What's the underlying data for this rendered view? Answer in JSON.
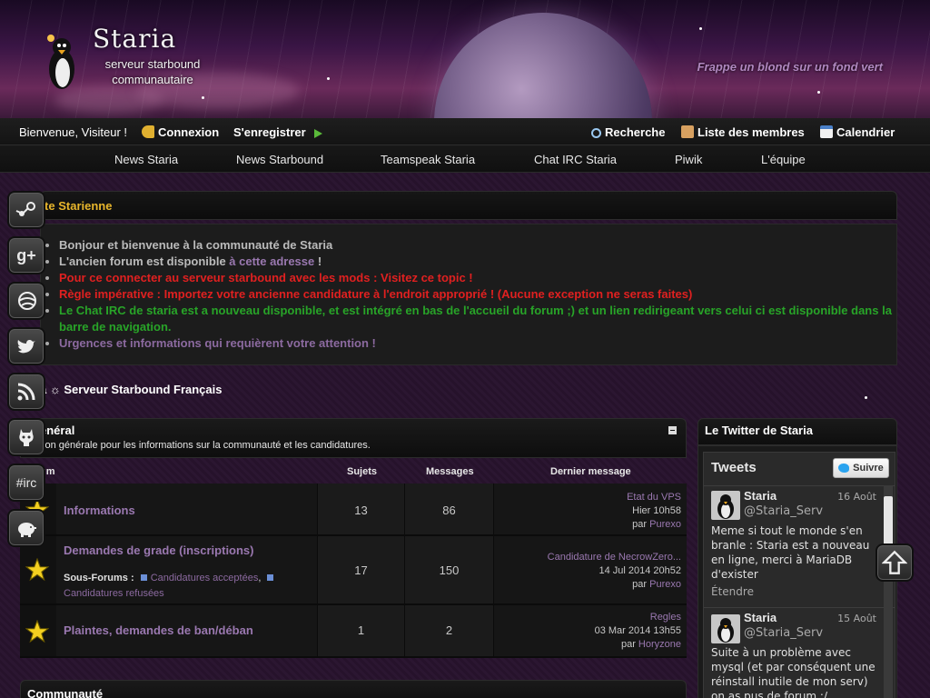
{
  "banner": {
    "logo_title": "Staria",
    "logo_sub_1": "serveur starbound",
    "logo_sub_2": "communautaire",
    "tagline": "Frappe un blond sur un fond vert"
  },
  "userbar": {
    "welcome": "Bienvenue, Visiteur !",
    "login": "Connexion",
    "register": "S'enregistrer",
    "search": "Recherche",
    "members": "Liste des membres",
    "calendar": "Calendrier"
  },
  "nav": [
    "News Staria",
    "News Starbound",
    "Teamspeak Staria",
    "Chat IRC Staria",
    "Piwik",
    "L'équipe"
  ],
  "social": [
    {
      "icon": "steam-icon",
      "glyph": ""
    },
    {
      "icon": "google-plus-icon",
      "glyph": "g+"
    },
    {
      "icon": "starbound-icon",
      "glyph": ""
    },
    {
      "icon": "twitter-icon",
      "glyph": ""
    },
    {
      "icon": "rss-icon",
      "glyph": ""
    },
    {
      "icon": "github-icon",
      "glyph": ""
    },
    {
      "icon": "irc-icon",
      "glyph": "#irc"
    },
    {
      "icon": "piggy-bank-icon",
      "glyph": ""
    }
  ],
  "alert": {
    "title": "rte Starienne",
    "items": [
      {
        "text": "Bonjour et bienvenue à la communauté de Staria",
        "style": "normal"
      },
      {
        "text": "L'ancien forum est disponible ",
        "link": "à cette adresse",
        "after": " !",
        "style": "normal"
      },
      {
        "text": "Pour ce connecter au serveur starbound avec les mods : Visitez ce topic !",
        "style": "red"
      },
      {
        "text": "Règle impérative : Importez votre ancienne candidature à l'endroit approprié ! (Aucune exception ne seras faites)",
        "style": "red"
      },
      {
        "text": "Le Chat IRC de staria est a nouveau disponible, et est intégré en bas de l'accueil du forum ;) et un lien redirigeant vers celui ci est disponible dans la barre de navigation.",
        "style": "green"
      },
      {
        "text": "Urgences et informations qui requièrent votre attention !",
        "style": "purple"
      }
    ]
  },
  "breadcrumb": "a ☼ Serveur Starbound Français",
  "category": {
    "title": "énéral",
    "description": "tion générale pour les informations sur la communauté et les candidatures.",
    "columns": {
      "forum": "um",
      "topics": "Sujets",
      "messages": "Messages",
      "last": "Dernier message"
    }
  },
  "forums": [
    {
      "name": "Informations",
      "topics": "13",
      "messages": "86",
      "last_title": "Etat du VPS",
      "last_date": "Hier 10h58",
      "last_by": "par",
      "last_user": "Purexo"
    },
    {
      "name": "Demandes de grade (inscriptions)",
      "topics": "17",
      "messages": "150",
      "last_title": "Candidature de NecrowZero...",
      "last_date": "14 Jul 2014 20h52",
      "last_by": "par",
      "last_user": "Purexo",
      "subforums_label": "Sous-Forums :",
      "subforums": [
        "Candidatures acceptées",
        "Candidatures refusées"
      ]
    },
    {
      "name": "Plaintes, demandes de ban/déban",
      "topics": "1",
      "messages": "2",
      "last_title": "Regles",
      "last_date": "03 Mar 2014 13h55",
      "last_by": "par",
      "last_user": "Horyzone"
    }
  ],
  "category2": {
    "title": "Communauté"
  },
  "twitter": {
    "panel_title": "Le Twitter de Staria",
    "title": "Tweets",
    "follow": "Suivre",
    "tweets": [
      {
        "name": "Staria",
        "handle": "@Staria_Serv",
        "date": "16 Août",
        "text": "Meme si tout le monde s'en branle : Staria est a nouveau en ligne, merci à MariaDB d'exister",
        "expand": "Étendre"
      },
      {
        "name": "Staria",
        "handle": "@Staria_Serv",
        "date": "15 Août",
        "text": "Suite à un problème avec mysql (et par conséquent une réinstall inutile de mon serv) on as pus de forum :/"
      }
    ]
  },
  "colors": {
    "accent_purple": "#9a78b0",
    "alert_red": "#e02020",
    "alert_green": "#28a428",
    "alert_title": "#e8b62c"
  }
}
